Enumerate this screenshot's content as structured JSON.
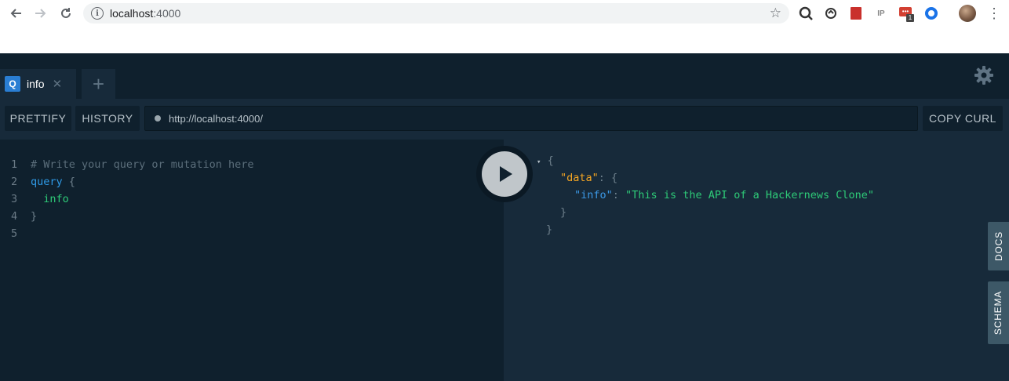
{
  "browser": {
    "url_host": "localhost",
    "url_port": ":4000",
    "extension_badge": "1"
  },
  "tab": {
    "icon_letter": "Q",
    "label": "info",
    "close_glyph": "✕",
    "add_glyph": "+"
  },
  "toolbar": {
    "prettify_label": "PRETTIFY",
    "history_label": "HISTORY",
    "endpoint_url": "http://localhost:4000/",
    "copy_curl_label": "COPY CURL"
  },
  "editor": {
    "line_numbers": [
      "1",
      "2",
      "3",
      "4",
      "5"
    ],
    "lines": {
      "l1_comment": "# Write your query or mutation here",
      "l2_keyword": "query",
      "l2_brace": " {",
      "l3_field": "  info",
      "l4_brace": "}"
    }
  },
  "result": {
    "arrow": "▾",
    "open_brace": "{",
    "data_key": "\"data\"",
    "colon1": ": {",
    "info_key": "\"info\"",
    "colon2": ": ",
    "info_value": "\"This is the API of a Hackernews Clone\"",
    "inner_close": "}",
    "outer_close": "}"
  },
  "side_tabs": {
    "docs_label": "DOCS",
    "schema_label": "SCHEMA"
  },
  "colors": {
    "background": "#172a3a",
    "panel": "#0f202d",
    "accent": "#2a7ed3",
    "string": "#2ecb78",
    "key": "#f5a623"
  }
}
